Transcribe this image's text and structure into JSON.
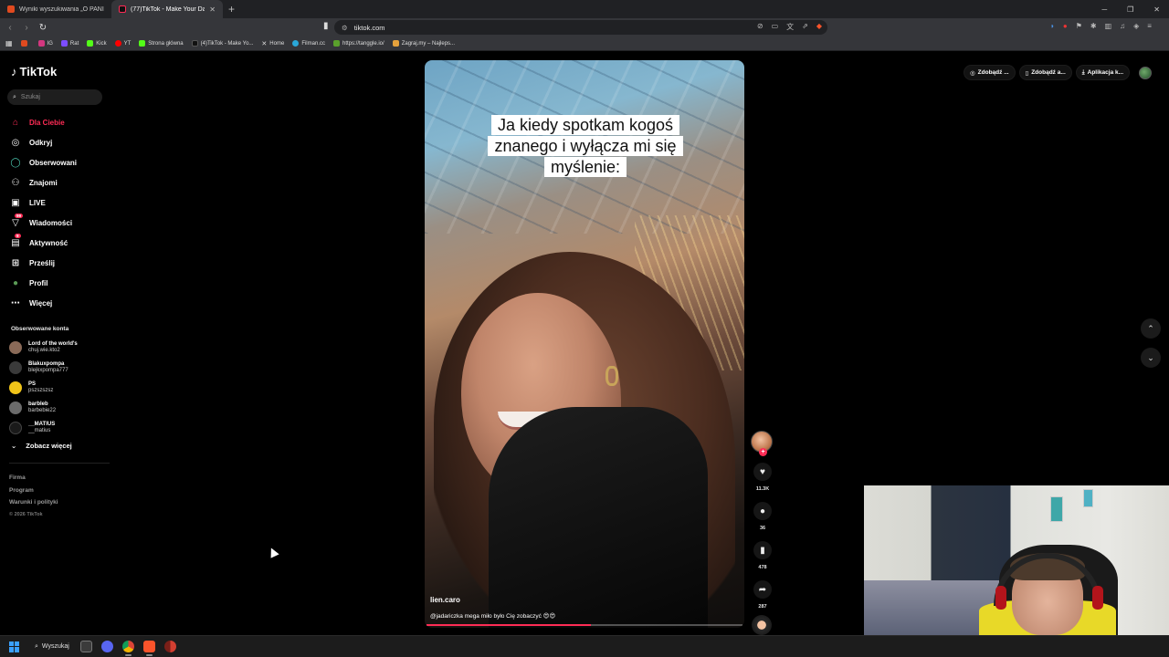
{
  "browser": {
    "tabs": [
      {
        "label": "Wyniki wyszukiwania „O PANI” w serwisie",
        "active": false,
        "color": "#e04a1f"
      },
      {
        "label": "(77)TikTok - Make Your Day",
        "active": true,
        "color": "#111111"
      }
    ],
    "new_tab_glyph": "+",
    "url": "tiktok.com",
    "bookmarks": [
      {
        "label": "",
        "color": "#e04a1f"
      },
      {
        "label": "IG",
        "color": "#d3377f"
      },
      {
        "label": "Rat",
        "color": "#7c4dff"
      },
      {
        "label": "Kick",
        "color": "#53fc18"
      },
      {
        "label": "YT",
        "color": "#ff0000"
      },
      {
        "label": "Strona główna",
        "color": "#53fc18"
      },
      {
        "label": "(4)TikTok - Make Yo...",
        "color": "#111111"
      },
      {
        "label": "Home",
        "color": "#111111"
      },
      {
        "label": "Filman.cc",
        "color": "#2aa7d8"
      },
      {
        "label": "https://tanggle.io/",
        "color": "#5aa02c"
      },
      {
        "label": "Zagraj.my – Najleps...",
        "color": "#e6a23c"
      }
    ]
  },
  "tiktok": {
    "logo": "TikTok",
    "search_placeholder": "Szukaj",
    "nav": [
      {
        "label": "Dla Ciebie",
        "icon": "home-icon",
        "glyph": "⌂",
        "active": true
      },
      {
        "label": "Odkryj",
        "icon": "compass-icon",
        "glyph": "◎",
        "active": false
      },
      {
        "label": "Obserwowani",
        "icon": "following-avatar-icon",
        "glyph": "◯",
        "active": false
      },
      {
        "label": "Znajomi",
        "icon": "friends-icon",
        "glyph": "⚇",
        "active": false
      },
      {
        "label": "LIVE",
        "icon": "live-icon",
        "glyph": "▣",
        "active": false
      },
      {
        "label": "Wiadomości",
        "icon": "messages-icon",
        "glyph": "▽",
        "active": false,
        "badge": "99"
      },
      {
        "label": "Aktywność",
        "icon": "activity-icon",
        "glyph": "▤",
        "active": false,
        "badge": "9"
      },
      {
        "label": "Prześlij",
        "icon": "upload-icon",
        "glyph": "⊞",
        "active": false
      },
      {
        "label": "Profil",
        "icon": "profile-icon",
        "glyph": "●",
        "active": false
      },
      {
        "label": "Więcej",
        "icon": "more-icon",
        "glyph": "⋯",
        "active": false
      }
    ],
    "following_title": "Obserwowane konta",
    "following": [
      {
        "nick": "Lord of the world's",
        "user": "chuj.wie.kto2",
        "color": "#8a6a58"
      },
      {
        "nick": "Blakuxpompa",
        "user": "blejkxpompa777",
        "color": "#3a3a3a"
      },
      {
        "nick": "PS",
        "user": "pszszszsz",
        "color": "#f0c419"
      },
      {
        "nick": "barbleb",
        "user": "barbebie22",
        "color": "#6b6b6b"
      },
      {
        "nick": "__MATIUS",
        "user": "__matius",
        "color": "#1a1a1a"
      }
    ],
    "see_more": "Zobacz więcej",
    "footer": [
      "Firma",
      "Program",
      "Warunki i polityki"
    ],
    "copyright": "© 2026 TikTok",
    "top_buttons": [
      "Zdobądź ...",
      "Zdobądź a...",
      "Aplikacja k..."
    ],
    "video": {
      "caption_lines": [
        "Ja kiedy spotkam kogoś",
        "znanego i wyłącza mi się",
        "myślenie:"
      ],
      "author": "lien.caro",
      "description": "@jadariczka mega miło było Cię zobaczyć 😍😍",
      "progress": 0.52
    },
    "actions": [
      {
        "icon": "heart-icon",
        "glyph": "♥",
        "count": "11.3K"
      },
      {
        "icon": "comment-icon",
        "glyph": "●",
        "count": "36"
      },
      {
        "icon": "bookmark-icon",
        "glyph": "▮",
        "count": "478"
      },
      {
        "icon": "share-icon",
        "glyph": "➦",
        "count": "287"
      }
    ]
  },
  "taskbar": {
    "search_label": "Wyszukaj",
    "apps": [
      {
        "name": "file-manager-app",
        "color": "#3b3b3b"
      },
      {
        "name": "discord-app",
        "color": "#5865f2"
      },
      {
        "name": "chrome-app",
        "color": "#2f9e44"
      },
      {
        "name": "brave-app",
        "color": "#fb542b"
      },
      {
        "name": "chrome-alt-app",
        "color": "#d23f31"
      }
    ]
  }
}
